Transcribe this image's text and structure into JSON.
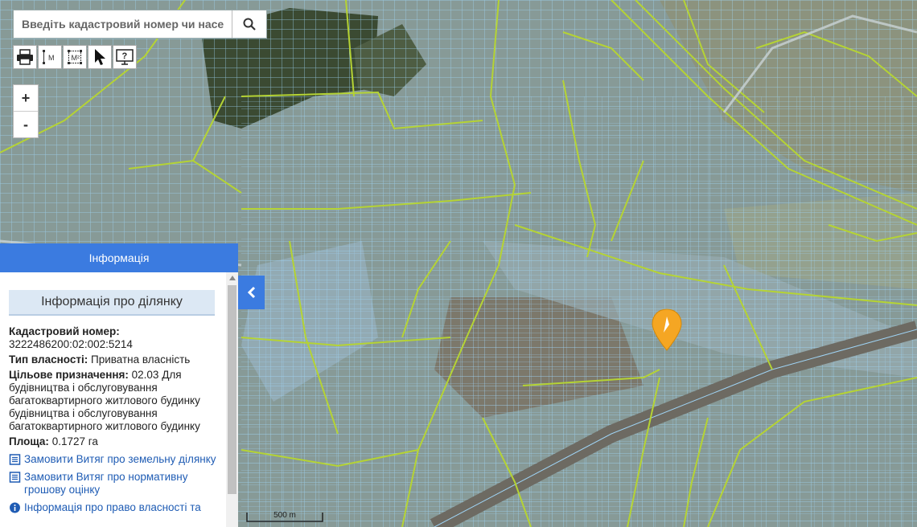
{
  "search": {
    "placeholder": "Введіть кадастровий номер чи населе"
  },
  "toolbar": {
    "icons": [
      "print-icon",
      "measure-line-icon",
      "measure-area-icon",
      "pointer-icon",
      "help-icon"
    ],
    "line_label": "M",
    "area_label": "M²",
    "help_label": "?"
  },
  "zoom": {
    "in": "+",
    "out": "-"
  },
  "panel": {
    "header": "Інформація",
    "subheader": "Інформація про ділянку",
    "cadastral_label": "Кадастровий номер:",
    "cadastral_value": "3222486200:02:002:5214",
    "ownership_label": "Тип власності:",
    "ownership_value": "Приватна власність",
    "purpose_label": "Цільове призначення:",
    "purpose_value": "02.03 Для будівництва і обслуговування багатоквартирного житлового будинку будівництва і обслуговування багатоквартирного житлового будинку",
    "area_label": "Площа:",
    "area_value": "0.1727 га",
    "links": [
      "Замовити Витяг про земельну ділянку",
      "Замовити Витяг про нормативну грошову оцінку",
      "Інформація про право власності та"
    ]
  },
  "scale": {
    "label": "500 m"
  },
  "colors": {
    "parcel": "#8cc8f0",
    "boundary": "#b5d334",
    "marker": "#f5a623",
    "accent": "#3b7be0"
  }
}
